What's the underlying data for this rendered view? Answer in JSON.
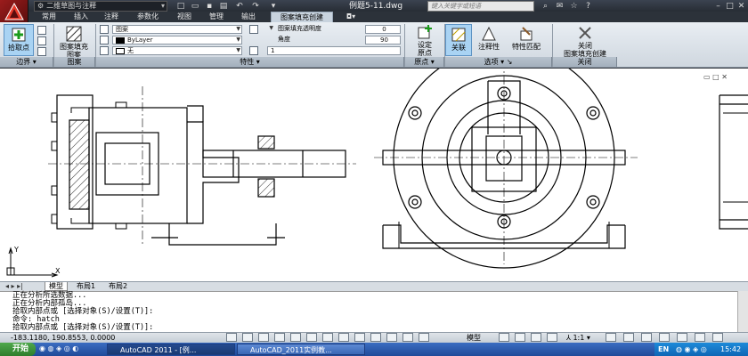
{
  "window": {
    "title": "例题5-11.dwg",
    "workspace": "二维草图与注释",
    "search_placeholder": "键入关键字或短语",
    "tabs": [
      "常用",
      "插入",
      "注释",
      "参数化",
      "视图",
      "管理",
      "输出",
      "图案填充创建"
    ],
    "active_tab": "图案填充创建"
  },
  "ribbon": {
    "groups": {
      "boundary": {
        "label": "边界",
        "pick_point": "拾取点"
      },
      "pattern": {
        "label": "图案",
        "pattern_fill": "图案填充\n图案"
      },
      "properties": {
        "label": "特性",
        "pattern_type": "图案",
        "color": "ByLayer",
        "background": "无",
        "transparency_label": "图案填充透明度",
        "transparency_value": "0",
        "angle_label": "角度",
        "angle_value": "90",
        "scale_value": "1"
      },
      "origin": {
        "label": "原点",
        "set_origin": "设定\n原点"
      },
      "options": {
        "label": "选项",
        "associative": "关联",
        "annotative": "注释性",
        "match_properties": "特性匹配"
      },
      "close": {
        "label": "关闭",
        "close_button": "关闭\n图案填充创建"
      }
    }
  },
  "layout_tabs": [
    "模型",
    "布局1",
    "布局2"
  ],
  "active_layout": "模型",
  "command_history": [
    "正在分析所选数据...",
    "正在分析内部孤岛...",
    "拾取内部点或 [选择对象(S)/设置(T)]:",
    "命令: hatch",
    "拾取内部点或 [选择对象(S)/设置(T)]:"
  ],
  "status": {
    "coordinates": "-183.1180, 190.8553, 0.0000",
    "model_label": "模型",
    "annotation_scale": "1:1"
  },
  "taskbar": {
    "start": "开始",
    "tasks": [
      "AutoCAD 2011 - [例...",
      "AutoCAD_2011实例教..."
    ],
    "clock": "15:42",
    "lang": "EN"
  },
  "colors": {
    "title_bar": "#2f353d",
    "ribbon": "#dfe5eb",
    "active_tab": "#c8d3de",
    "taskbar": "#2b5cb0"
  }
}
